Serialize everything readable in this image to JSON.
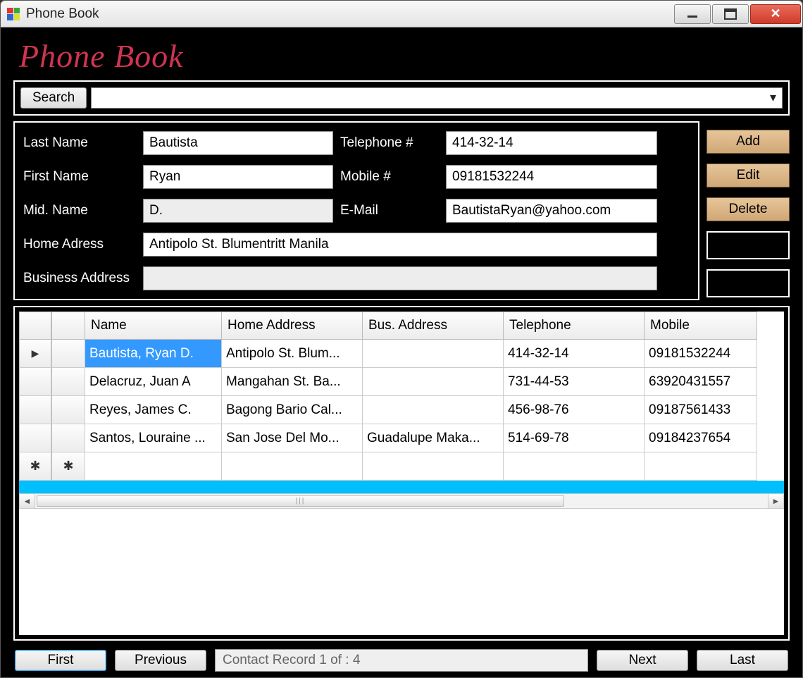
{
  "window": {
    "title": "Phone Book"
  },
  "logo": "Phone Book",
  "search": {
    "button": "Search",
    "value": ""
  },
  "form": {
    "labels": {
      "last_name": "Last Name",
      "first_name": "First Name",
      "mid_name": "Mid. Name",
      "telephone": "Telephone #",
      "mobile": "Mobile #",
      "email": "E-Mail",
      "home_address": "Home Adress",
      "business_address": "Business Address"
    },
    "values": {
      "last_name": "Bautista",
      "first_name": "Ryan",
      "mid_name": "D.",
      "telephone": "414-32-14",
      "mobile": "09181532244",
      "email": "BautistaRyan@yahoo.com",
      "home_address": "Antipolo St. Blumentritt Manila",
      "business_address": ""
    }
  },
  "actions": {
    "add": "Add",
    "edit": "Edit",
    "delete": "Delete"
  },
  "grid": {
    "columns": [
      "",
      "",
      "Name",
      "Home Address",
      "Bus. Address",
      "Telephone",
      "Mobile"
    ],
    "rows": [
      {
        "marker": true,
        "selected": true,
        "name": "Bautista, Ryan D.",
        "home": "Antipolo St. Blum...",
        "bus": "",
        "tel": "414-32-14",
        "mob": "09181532244"
      },
      {
        "name": "Delacruz, Juan A",
        "home": "Mangahan St. Ba...",
        "bus": "",
        "tel": "731-44-53",
        "mob": "63920431557"
      },
      {
        "name": "Reyes, James C.",
        "home": "Bagong Bario Cal...",
        "bus": "",
        "tel": "456-98-76",
        "mob": "09187561433"
      },
      {
        "name": "Santos, Louraine ...",
        "home": "San Jose Del Mo...",
        "bus": "Guadalupe Maka...",
        "tel": "514-69-78",
        "mob": "09184237654"
      }
    ]
  },
  "nav": {
    "first": "First",
    "previous": "Previous",
    "status": "Contact Record 1 of : 4",
    "next": "Next",
    "last": "Last"
  }
}
